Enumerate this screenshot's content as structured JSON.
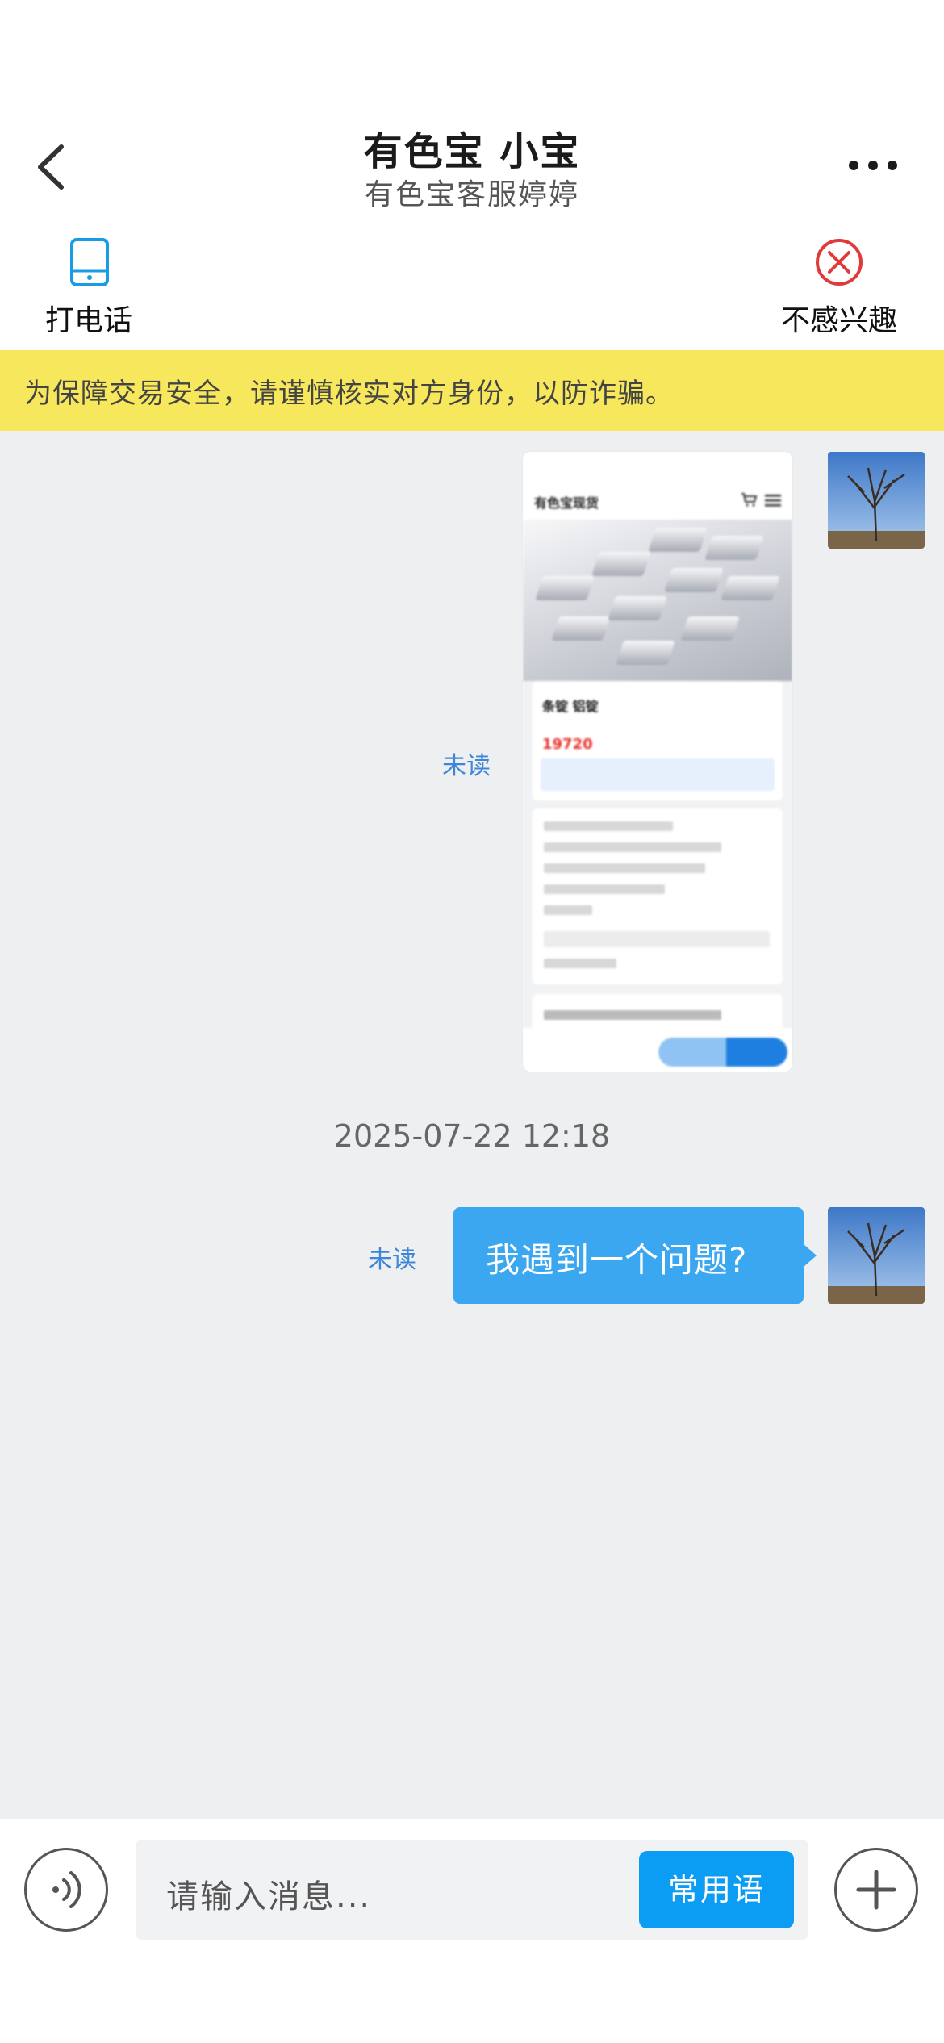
{
  "header": {
    "title": "有色宝 小宝",
    "subtitle": "有色宝客服婷婷"
  },
  "actions": {
    "call_label": "打电话",
    "not_interested_label": "不感兴趣"
  },
  "warning": "为保障交易安全，请谨慎核实对方身份，以防诈骗。",
  "messages": [
    {
      "type": "product-card",
      "status": "未读",
      "card": {
        "page_title": "有色宝现货",
        "product_name": "条锭 铝锭",
        "price": "19720"
      }
    },
    {
      "type": "timestamp",
      "text": "2025-07-22 12:18"
    },
    {
      "type": "text",
      "status": "未读",
      "text": "我遇到一个问题?"
    }
  ],
  "input": {
    "placeholder": "请输入消息...",
    "phrases_label": "常用语"
  },
  "colors": {
    "accent": "#3aa7f0",
    "warning_bg": "#f7e75c",
    "unread": "#3d86d8",
    "chat_bg": "#eeeff1"
  }
}
